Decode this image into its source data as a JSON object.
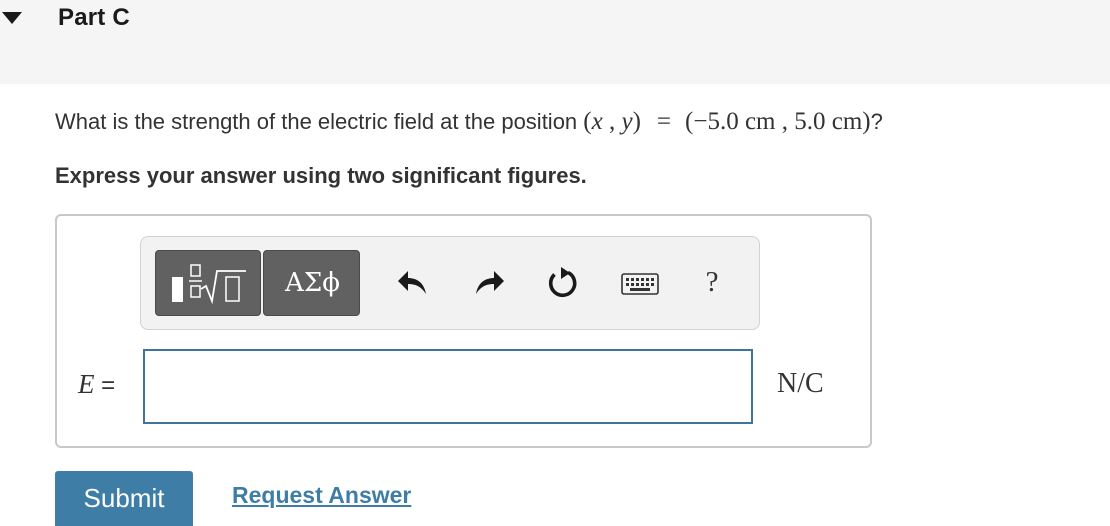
{
  "header": {
    "part_title": "Part C"
  },
  "question": {
    "text": "What is the strength of the electric field at the position",
    "math": {
      "open": "(",
      "var_x": "x",
      "comma": " , ",
      "var_y": "y",
      "close": ")",
      "equals": "=",
      "value": "(−5.0 cm , 5.0 cm)",
      "end": "?"
    }
  },
  "instruction": "Express your answer using two significant figures.",
  "toolbar": {
    "buttons": [
      {
        "name": "templates-button",
        "icon": "fraction-sqrt-template-icon"
      },
      {
        "name": "greek-symbols-button",
        "label": "ΑΣϕ"
      },
      {
        "name": "undo-button",
        "icon": "undo-arrow-icon"
      },
      {
        "name": "redo-button",
        "icon": "redo-arrow-icon"
      },
      {
        "name": "reset-button",
        "icon": "reset-circular-arrow-icon"
      },
      {
        "name": "keyboard-button",
        "icon": "keyboard-icon"
      },
      {
        "name": "help-button",
        "label": "?"
      }
    ]
  },
  "answer": {
    "variable": "E",
    "equals": " =",
    "value": "",
    "unit": "N/C"
  },
  "actions": {
    "submit_label": "Submit",
    "request_label": "Request Answer"
  },
  "colors": {
    "header_bg": "#f5f5f5",
    "toolbar_button_bg": "#616161",
    "input_border": "#3f7697",
    "primary": "#3e7ea6",
    "text": "#333333"
  }
}
